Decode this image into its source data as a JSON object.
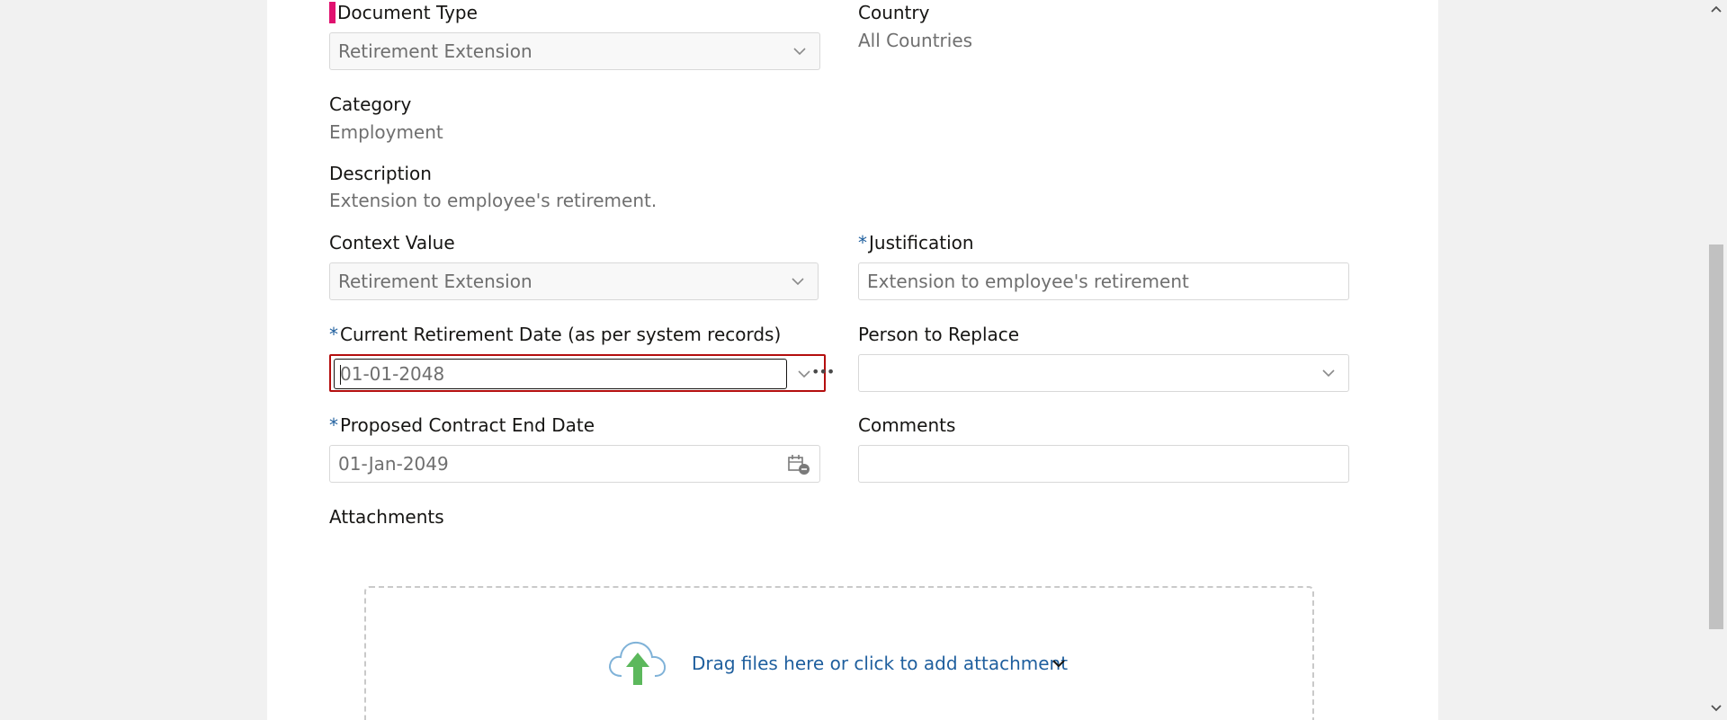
{
  "form": {
    "document_type": {
      "label": "Document Type",
      "value": "Retirement Extension"
    },
    "country": {
      "label": "Country",
      "value": "All Countries"
    },
    "category": {
      "label": "Category",
      "value": "Employment"
    },
    "description": {
      "label": "Description",
      "value": "Extension to employee's retirement."
    },
    "context_value": {
      "label": "Context Value",
      "value": "Retirement Extension"
    },
    "justification": {
      "label": "Justification",
      "value": "Extension to employee's retirement"
    },
    "current_retirement_date": {
      "label": "Current Retirement Date (as per system records)",
      "value": "01-01-2048"
    },
    "person_to_replace": {
      "label": "Person to Replace",
      "value": ""
    },
    "proposed_contract_end_date": {
      "label": "Proposed Contract End Date",
      "value": "01-Jan-2049"
    },
    "comments": {
      "label": "Comments",
      "value": ""
    },
    "attachments": {
      "label": "Attachments",
      "drop_text": "Drag files here or click to add attachment"
    },
    "required_marker": "*"
  },
  "icons": {
    "dropdown": "chevron-down-icon",
    "calendar": "calendar-icon",
    "upload": "cloud-upload-icon",
    "more": "more-icon"
  },
  "colors": {
    "required": "#1f5f9e",
    "error_border": "#b40e0e",
    "link": "#1f5f9e",
    "upload_arrow": "#5cb85c"
  }
}
